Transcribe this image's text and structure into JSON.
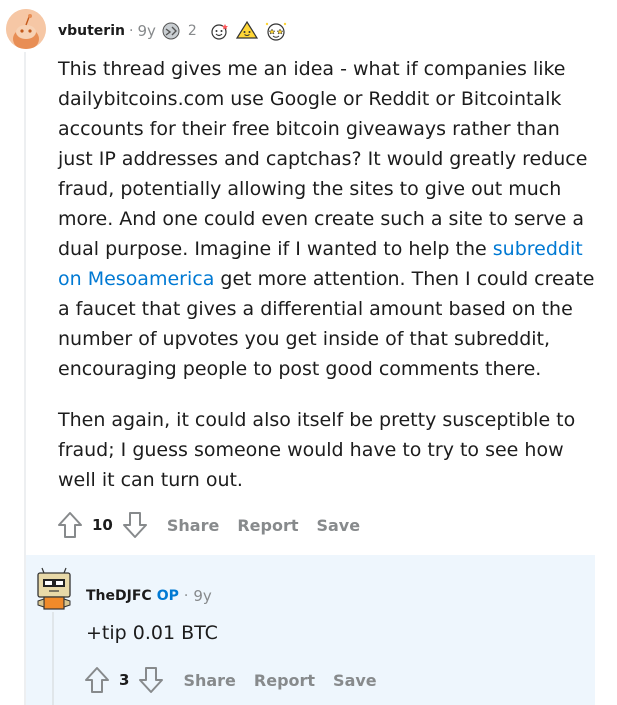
{
  "comment": {
    "author": "vbuterin",
    "separator": "·",
    "age": "9y",
    "award_count": "2",
    "awards": [
      "silver-award-icon",
      "wholesome-award-icon",
      "helpful-award-icon",
      "starstruck-award-icon"
    ],
    "body": {
      "p1_part1": "This thread gives me an idea - what if companies like dailybitcoins.com use Google or Reddit or Bitcointalk accounts for their free bitcoin giveaways rather than just IP addresses and captchas? It would greatly reduce fraud, potentially allowing the sites to give out much more. And one could even create such a site to serve a dual purpose. Imagine if I wanted to help the ",
      "p1_link": "subreddit on Mesoamerica",
      "p1_part2": " get more attention. Then I could create a faucet that gives a differential amount based on the number of upvotes you get inside of that subreddit, encouraging people to post good comments there.",
      "p2": "Then again, it could also itself be pretty susceptible to fraud; I guess someone would have to try to see how well it can turn out."
    },
    "score": "10",
    "actions": {
      "share": "Share",
      "report": "Report",
      "save": "Save"
    }
  },
  "reply": {
    "author": "TheDJFC",
    "op_label": "OP",
    "separator": "·",
    "age": "9y",
    "body": "+tip 0.01 BTC",
    "score": "3",
    "actions": {
      "share": "Share",
      "report": "Report",
      "save": "Save"
    }
  },
  "colors": {
    "link": "#0079d3",
    "muted": "#878a8c",
    "reply_bg": "#eef6fd"
  }
}
